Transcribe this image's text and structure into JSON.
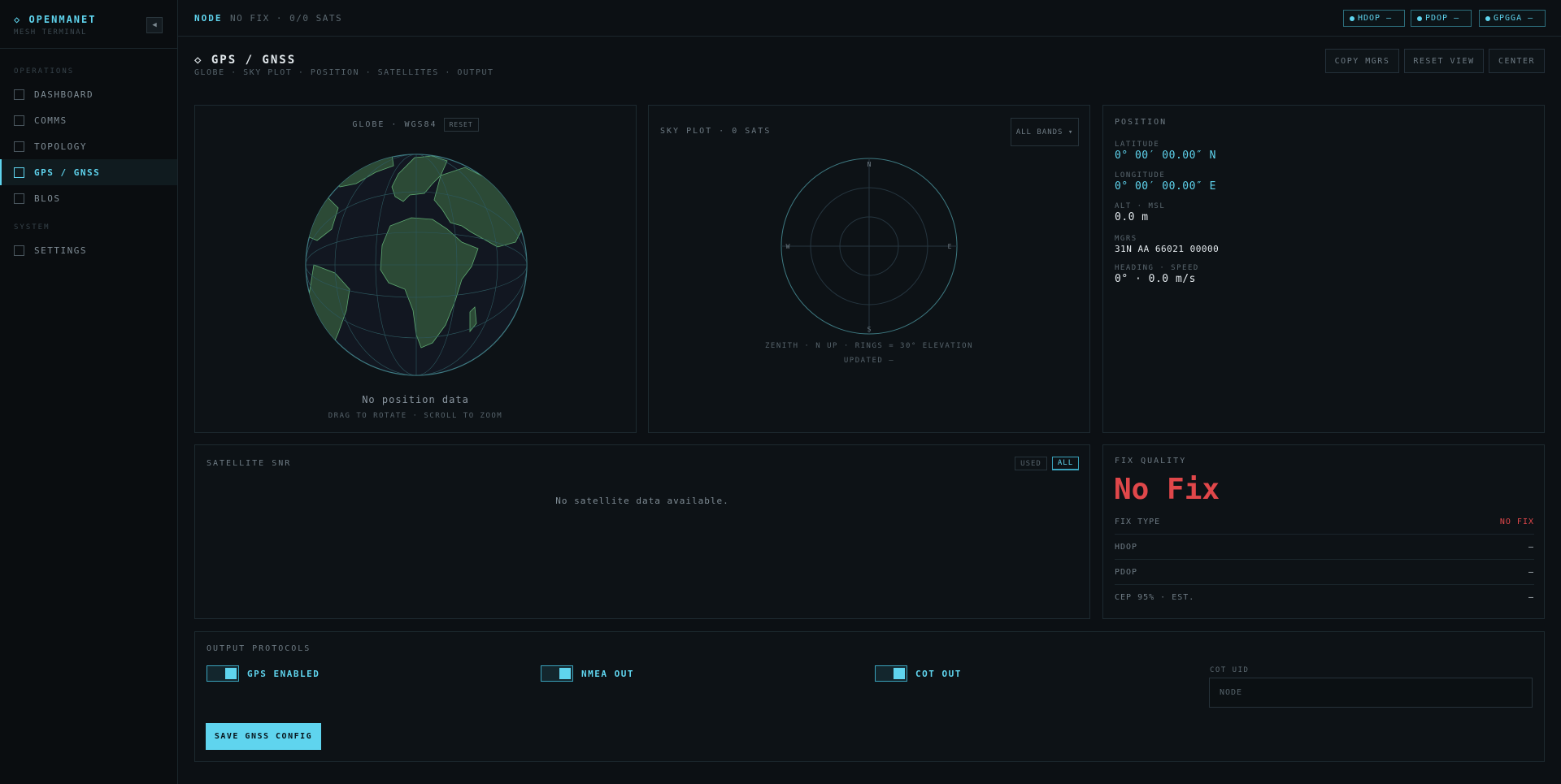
{
  "app": {
    "brand": "◇ OPENMANET",
    "brand_sub": "MESH TERMINAL",
    "collapse_icon": "◀"
  },
  "sidebar": {
    "section_ops": "OPERATIONS",
    "section_sys": "SYSTEM",
    "items": [
      {
        "label": "DASHBOARD"
      },
      {
        "label": "COMMS"
      },
      {
        "label": "TOPOLOGY"
      },
      {
        "label": "GPS / GNSS",
        "active": true
      },
      {
        "label": "BLOS"
      },
      {
        "label": "SETTINGS"
      }
    ]
  },
  "topbar": {
    "node_label": "NODE",
    "node_status": "NO FIX · 0/0 SATS",
    "pills": [
      {
        "label": "HDOP —"
      },
      {
        "label": "PDOP —"
      },
      {
        "label": "GPGGA —"
      }
    ]
  },
  "header": {
    "title": "◇ GPS / GNSS",
    "subtitle": "GLOBE · SKY PLOT · POSITION · SATELLITES · OUTPUT",
    "buttons": {
      "copy_mgrs": "COPY MGRS",
      "reset_view": "RESET VIEW",
      "center": "CENTER"
    }
  },
  "globe": {
    "title": "GLOBE · WGS84",
    "reset": "RESET",
    "status": "No position data",
    "hint": "DRAG TO ROTATE · SCROLL TO ZOOM"
  },
  "skyplot": {
    "title": "SKY PLOT · 0 SATS",
    "band_select": "ALL BANDS ▾",
    "compass": {
      "n": "N",
      "e": "E",
      "s": "S",
      "w": "W"
    },
    "caption": "ZENITH · N UP · RINGS = 30° ELEVATION",
    "updated": "UPDATED —"
  },
  "position": {
    "title": "POSITION",
    "lat_label": "LATITUDE",
    "lat": "0° 00′ 00.00″ N",
    "lon_label": "LONGITUDE",
    "lon": "0° 00′ 00.00″ E",
    "alt_label": "ALT · MSL",
    "alt": "0.0 m",
    "mgrs_label": "MGRS",
    "mgrs": "31N AA 66021 00000",
    "hs_label": "HEADING · SPEED",
    "hs": "0° · 0.0 m/s"
  },
  "snr": {
    "title": "SATELLITE SNR",
    "used": "USED",
    "all": "ALL",
    "empty": "No satellite data available."
  },
  "fix": {
    "title": "FIX QUALITY",
    "big": "No Fix",
    "rows": [
      {
        "label": "FIX TYPE",
        "value": "NO FIX"
      },
      {
        "label": "HDOP",
        "value": "—"
      },
      {
        "label": "PDOP",
        "value": "—"
      },
      {
        "label": "CEP 95% · EST.",
        "value": "—"
      }
    ]
  },
  "output": {
    "title": "OUTPUT PROTOCOLS",
    "gps_enabled": "GPS ENABLED",
    "nmea_out": "NMEA OUT",
    "cot_out": "COT OUT",
    "uid_label": "COT UID",
    "uid_placeholder": "NODE",
    "save": "SAVE GNSS CONFIG"
  },
  "colors": {
    "accent": "#5fd4ee",
    "danger": "#e0474a",
    "bg": "#0c1014",
    "land": "#2c4a36"
  }
}
